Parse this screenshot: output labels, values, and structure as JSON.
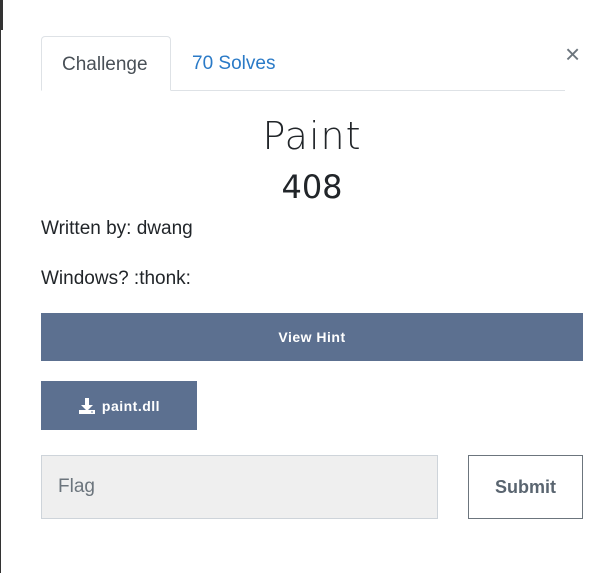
{
  "tabs": {
    "challenge": "Challenge",
    "solves": "70 Solves"
  },
  "close_label": "×",
  "challenge": {
    "name": "Paint",
    "points": "408",
    "author": "Written by: dwang",
    "description": "Windows? :thonk:"
  },
  "buttons": {
    "hint": "View Hint",
    "file": "paint.dll",
    "submit": "Submit"
  },
  "flag_input": {
    "placeholder": "Flag",
    "value": ""
  },
  "icons": {
    "close": "close-icon",
    "download": "download-icon"
  },
  "colors": {
    "button_bg": "#5c7090",
    "link": "#2a7ac7"
  }
}
